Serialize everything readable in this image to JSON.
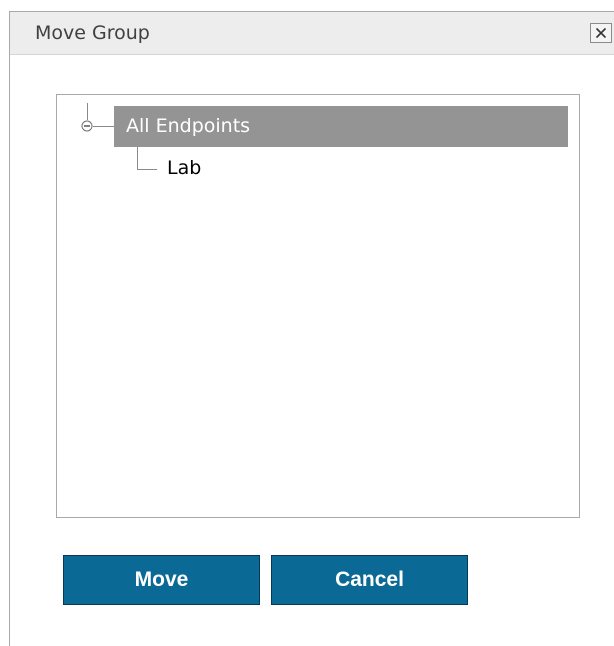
{
  "dialog": {
    "title": "Move Group",
    "close_icon": "close-x-icon"
  },
  "tree": {
    "root": {
      "label": "All Endpoints",
      "expanded": true,
      "selected": true,
      "toggle_icon": "collapse-minus-icon"
    },
    "children": [
      {
        "label": "Lab"
      }
    ]
  },
  "buttons": {
    "move_label": "Move",
    "cancel_label": "Cancel"
  },
  "colors": {
    "button_bg": "#0a6a95",
    "selected_node_bg": "#949494",
    "titlebar_bg": "#ededed"
  }
}
